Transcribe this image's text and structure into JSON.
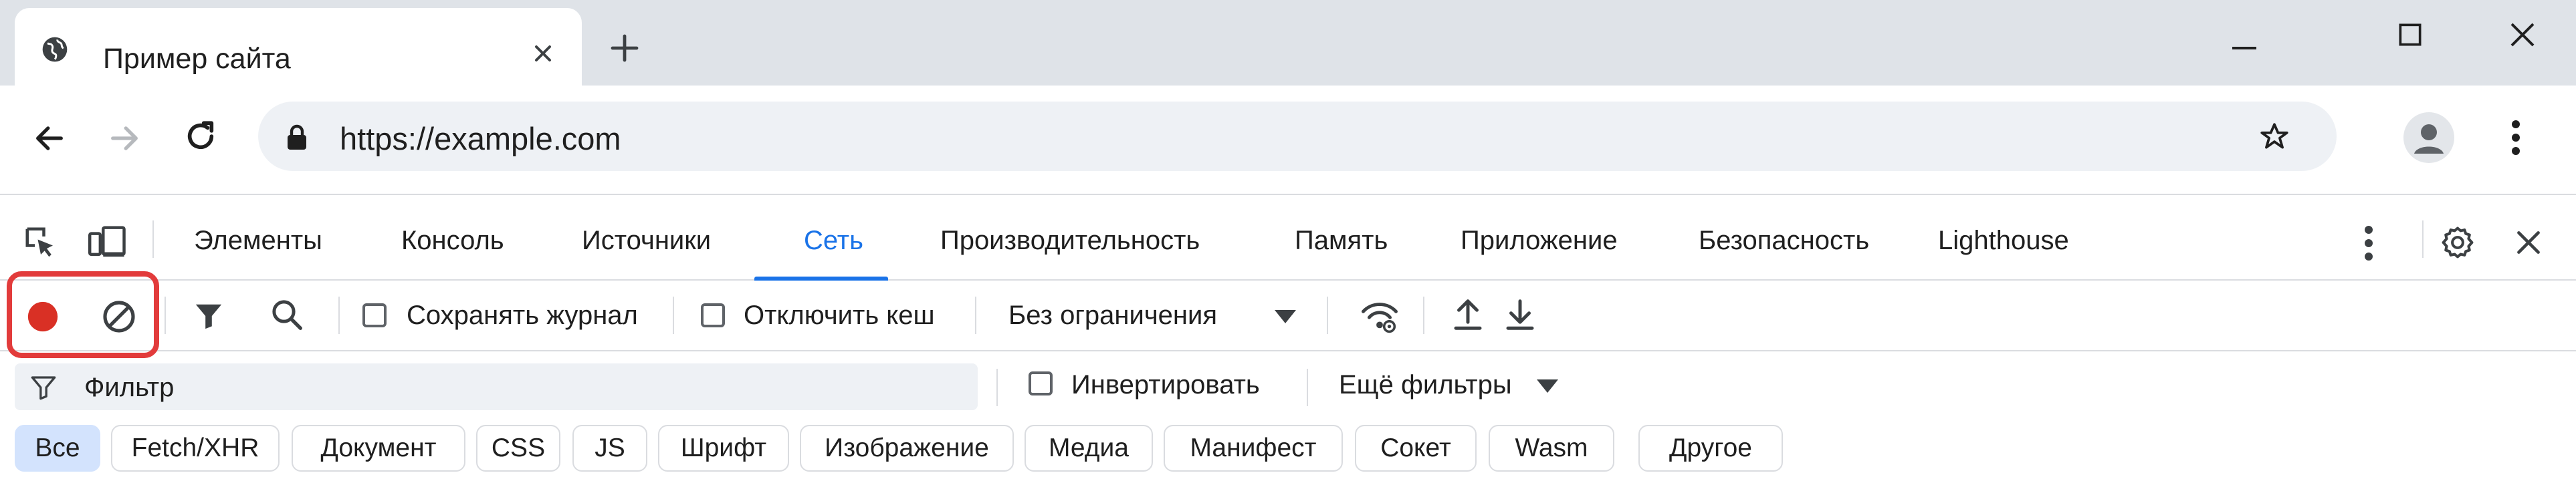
{
  "browser": {
    "tab": {
      "title": "Пример сайта"
    },
    "url": "https://example.com"
  },
  "devtools": {
    "tabs": [
      {
        "label": "Элементы"
      },
      {
        "label": "Консоль"
      },
      {
        "label": "Источники"
      },
      {
        "label": "Сеть",
        "active": true
      },
      {
        "label": "Производительность"
      },
      {
        "label": "Память"
      },
      {
        "label": "Приложение"
      },
      {
        "label": "Безопасность"
      },
      {
        "label": "Lighthouse"
      }
    ],
    "network": {
      "preserve_log_label": "Сохранять журнал",
      "disable_cache_label": "Отключить кеш",
      "throttling_value": "Без ограничения",
      "filter_placeholder": "Фильтр",
      "invert_label": "Инвертировать",
      "more_filters_label": "Ещё фильтры",
      "types": [
        "Все",
        "Fetch/XHR",
        "Документ",
        "CSS",
        "JS",
        "Шрифт",
        "Изображение",
        "Медиа",
        "Манифест",
        "Сокет",
        "Wasm",
        "Другое"
      ],
      "active_type": "Все"
    }
  },
  "colors": {
    "accent": "#1a73e8",
    "record": "#d93025",
    "highlight": "#e23b3b",
    "chip_active": "#d3e3fd"
  }
}
